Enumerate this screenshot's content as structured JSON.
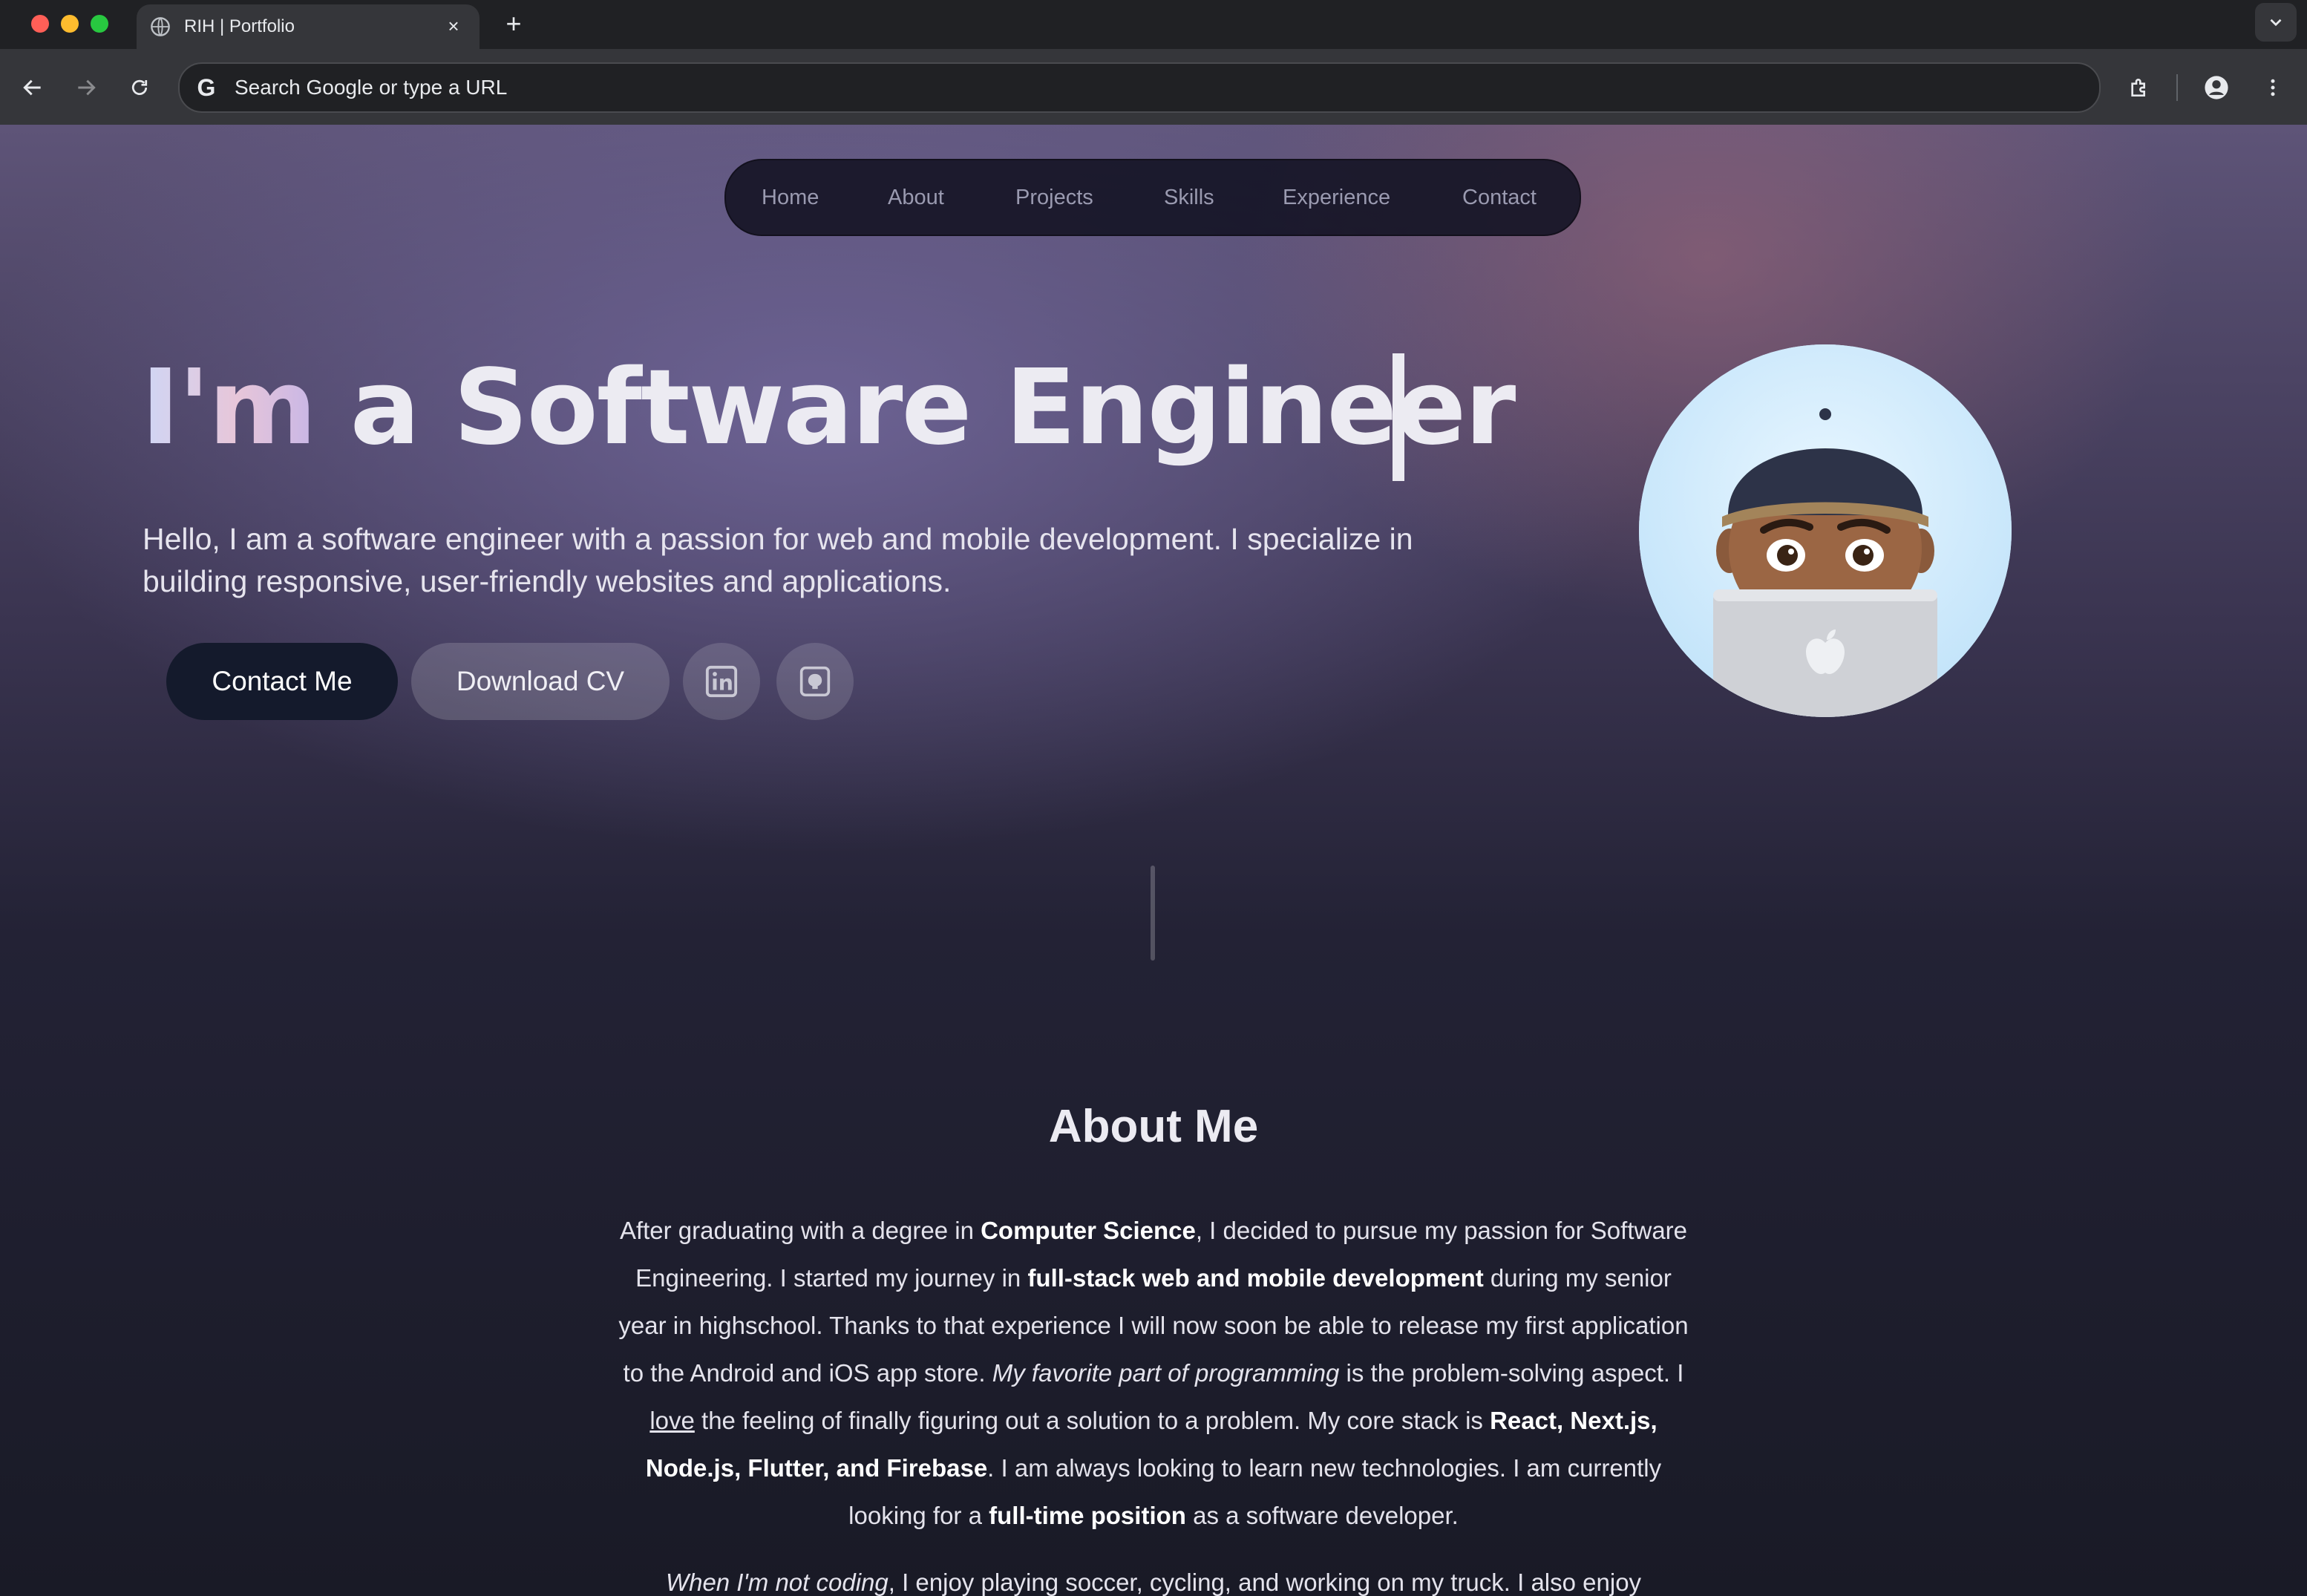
{
  "browser": {
    "tab_title": "RIH | Portfolio",
    "tab_close": "×",
    "new_tab": "+",
    "address_placeholder": "Search Google or type a URL"
  },
  "nav": {
    "items": [
      {
        "label": "Home"
      },
      {
        "label": "About"
      },
      {
        "label": "Projects"
      },
      {
        "label": "Skills"
      },
      {
        "label": "Experience"
      },
      {
        "label": "Contact"
      }
    ]
  },
  "hero": {
    "title_gradient": "I'm",
    "title_rest": "a Software Engineer",
    "subtitle": "Hello, I am a software engineer with a passion for web and mobile development. I specialize in building responsive, user-friendly websites and applications.",
    "contact_button": "Contact Me",
    "cv_button": "Download CV",
    "social_icons": [
      "linkedin-icon",
      "github-icon"
    ]
  },
  "about": {
    "title": "About Me",
    "p1": {
      "t1": "After graduating with a degree in ",
      "b1": "Computer Science",
      "t2": ", I decided to pursue my passion for Software Engineering. I started my journey in ",
      "b2": "full-stack web and mobile development",
      "t3": " during my senior year in highschool. Thanks to that experience I will now soon be able to release my first application to the Android and iOS app store. ",
      "i1": "My favorite part of programming",
      "t4": " is the problem-solving aspect. I ",
      "u1": "love",
      "t5": " the feeling of finally figuring out a solution to a problem. My core stack is ",
      "b3": "React, Next.js, Node.js, Flutter, and Firebase",
      "t6": ". I am always looking to learn new technologies. I am currently looking for a ",
      "b4": "full-time position",
      "t7": " as a software developer."
    },
    "p2": {
      "i1": "When I'm not coding",
      "t1": ", I enjoy playing soccer, cycling, and working on my truck. I also enjoy"
    }
  },
  "colors": {
    "nav_bg": "#161526",
    "primary_button": "#141a2c",
    "avatar_bg": "#d2ecfb"
  }
}
